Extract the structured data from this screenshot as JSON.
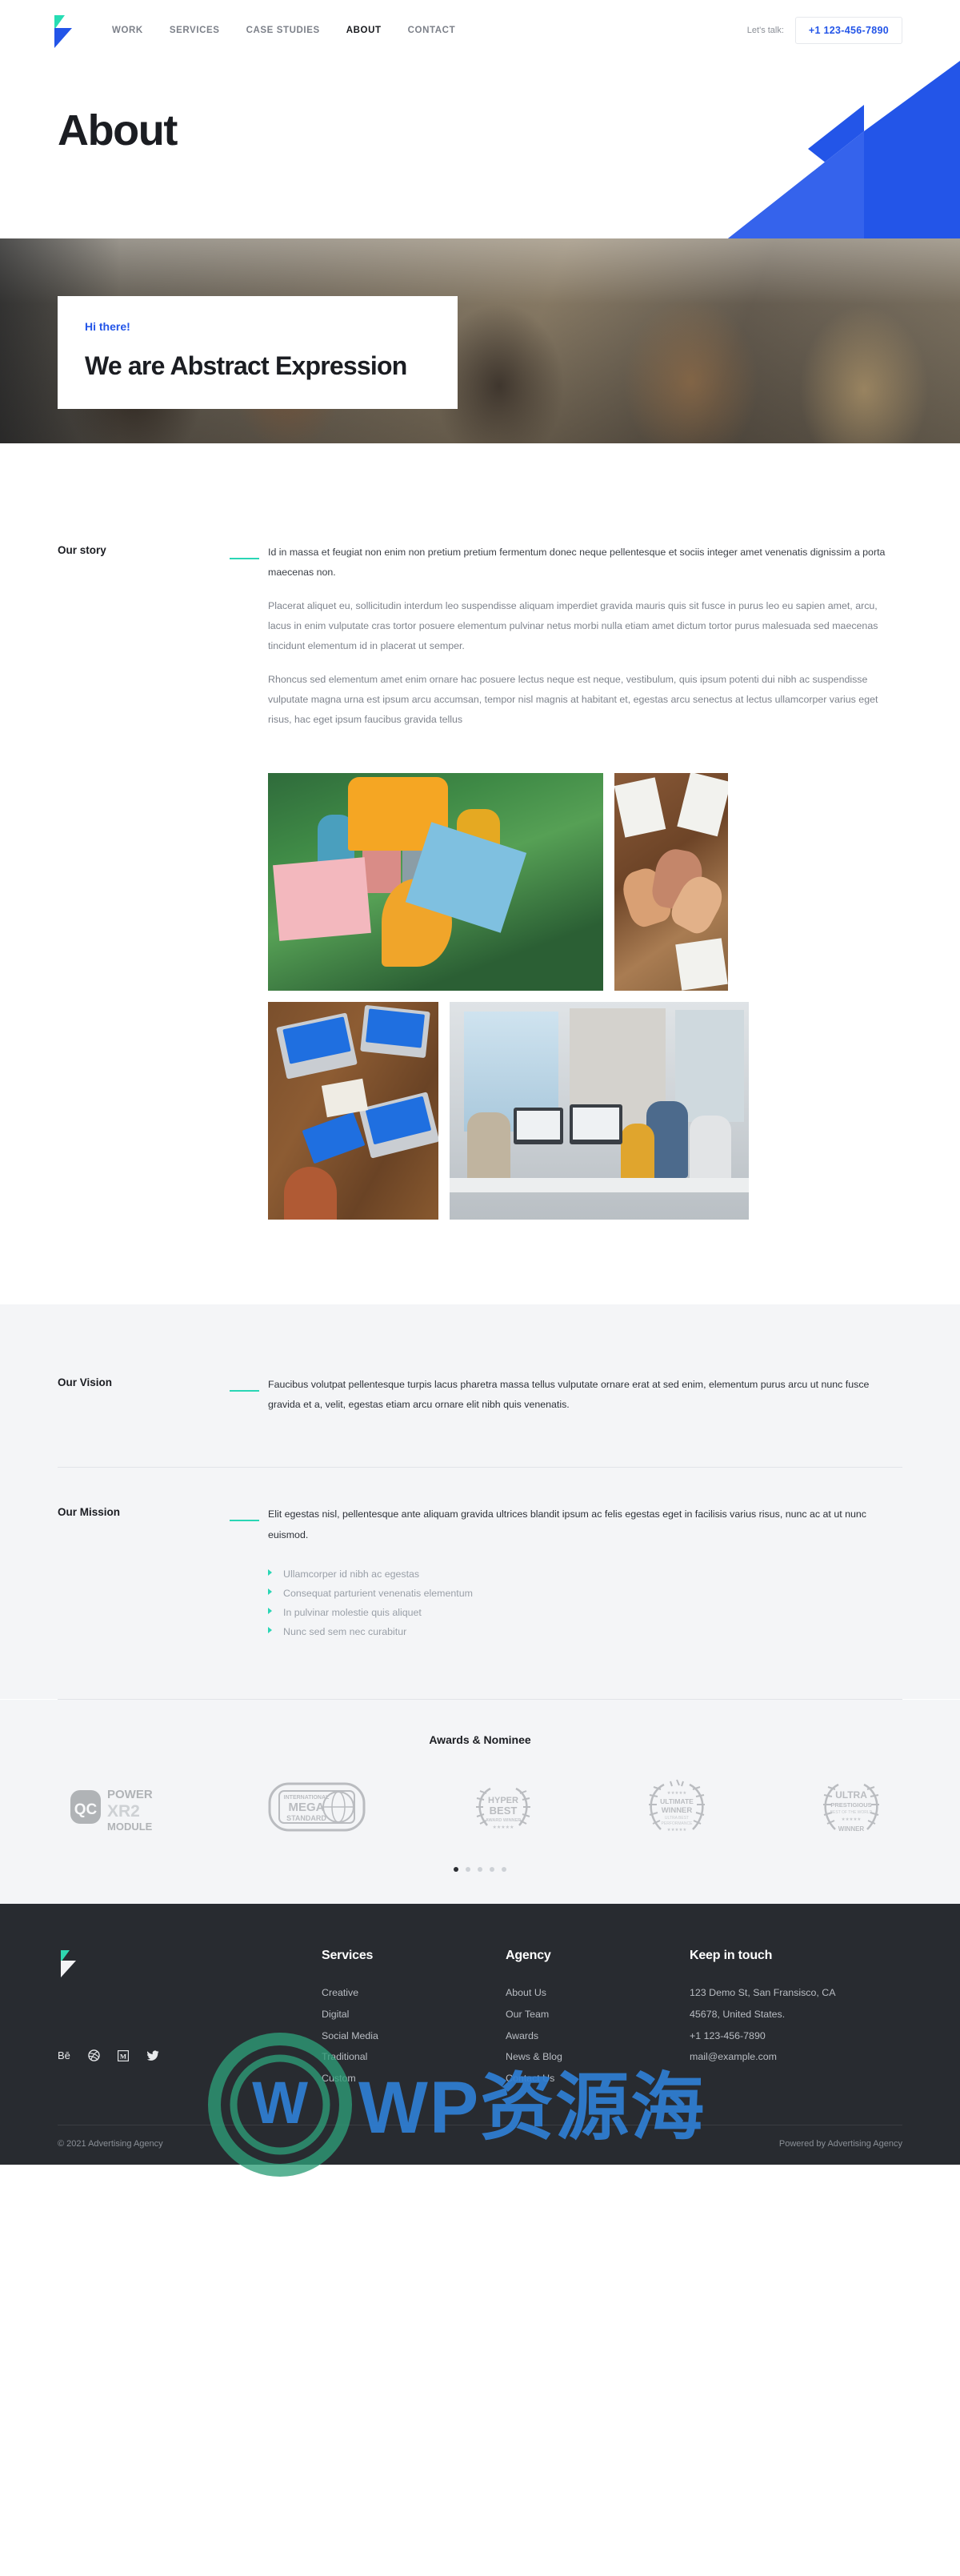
{
  "header": {
    "logo_name": "abstract-logo",
    "nav": [
      {
        "label": "WORK",
        "active": false
      },
      {
        "label": "SERVICES",
        "active": false
      },
      {
        "label": "CASE STUDIES",
        "active": false
      },
      {
        "label": "ABOUT",
        "active": true
      },
      {
        "label": "CONTACT",
        "active": false
      }
    ],
    "lets_talk_label": "Let's talk:",
    "phone": "+1 123-456-7890"
  },
  "page": {
    "title": "About"
  },
  "hero": {
    "kicker": "Hi there!",
    "heading": "We are Abstract Expression"
  },
  "story": {
    "label": "Our story",
    "paragraphs": [
      "Id in massa et feugiat non enim non pretium pretium fermentum donec neque pellentesque et sociis integer amet venenatis dignissim a porta maecenas non.",
      "Placerat aliquet eu, sollicitudin interdum leo suspendisse aliquam imperdiet gravida mauris quis sit fusce in purus leo eu sapien amet, arcu, lacus in enim vulputate cras tortor posuere elementum pulvinar netus morbi nulla etiam amet dictum tortor purus malesuada sed maecenas tincidunt elementum id in placerat ut semper.",
      "Rhoncus sed elementum amet enim ornare hac posuere lectus neque est neque, vestibulum, quis ipsum potenti dui nibh ac suspendisse vulputate magna urna est ipsum arcu accumsan, tempor nisl magnis at habitant et, egestas arcu senectus at lectus ullamcorper varius eget risus, hac eget ipsum faucibus gravida tellus"
    ],
    "gallery": [
      {
        "name": "team-with-colored-signs-photo"
      },
      {
        "name": "hands-together-teamwork-photo"
      },
      {
        "name": "desk-with-laptops-tablets-photo"
      },
      {
        "name": "office-meeting-photo"
      }
    ]
  },
  "vision": {
    "label": "Our Vision",
    "text": "Faucibus volutpat pellentesque turpis lacus pharetra massa tellus vulputate ornare erat at sed enim, elementum purus arcu ut nunc fusce gravida et a, velit, egestas etiam arcu ornare elit nibh quis venenatis."
  },
  "mission": {
    "label": "Our Mission",
    "text": "Elit egestas nisl, pellentesque ante aliquam gravida ultrices blandit ipsum ac felis egestas eget in facilisis varius risus, nunc ac at ut nunc euismod.",
    "items": [
      "Ullamcorper id nibh ac egestas",
      "Consequat parturient venenatis elementum",
      "In pulvinar molestie quis aliquet",
      "Nunc sed sem nec curabitur"
    ]
  },
  "awards": {
    "title": "Awards & Nominee",
    "badges": [
      {
        "name": "qc-power-xr2-module-badge",
        "lines": [
          "QC",
          "POWER",
          "XR2",
          "MODULE"
        ]
      },
      {
        "name": "international-mega-standard-badge",
        "lines": [
          "INTERNATIONAL",
          "MEGA",
          "STANDARD"
        ]
      },
      {
        "name": "hyper-best-award-winner-badge",
        "lines": [
          "HYPER",
          "BEST",
          "AWARD WINNER"
        ]
      },
      {
        "name": "ultimate-winner-badge",
        "lines": [
          "ULTIMATE",
          "WINNER",
          "ULTRA BEST",
          "PERFORMANCE"
        ]
      },
      {
        "name": "ultra-prestigious-winner-badge",
        "lines": [
          "ULTRA",
          "PRESTIGIOUS",
          "BEST OF THE WORLD",
          "WINNER"
        ]
      }
    ],
    "dots": 5,
    "active_dot": 0
  },
  "footer": {
    "socials": [
      {
        "name": "behance-icon",
        "glyph": "Bē"
      },
      {
        "name": "dribbble-icon",
        "glyph": "◉"
      },
      {
        "name": "medium-icon",
        "glyph": "Ⓜ"
      },
      {
        "name": "twitter-icon",
        "glyph": "🐦"
      }
    ],
    "columns": [
      {
        "title": "Services",
        "links": [
          "Creative",
          "Digital",
          "Social Media",
          "Traditional",
          "Custom"
        ]
      },
      {
        "title": "Agency",
        "links": [
          "About Us",
          "Our Team",
          "Awards",
          "News & Blog",
          "Contact Us"
        ]
      }
    ],
    "contact": {
      "title": "Keep in touch",
      "lines": [
        "123 Demo St, San Fransisco, CA",
        "45678, United States.",
        "+1 123-456-7890",
        "mail@example.com"
      ]
    },
    "copyright": "© 2021 Advertising Agency",
    "powered_by": "Powered by Advertising Agency"
  },
  "watermark": {
    "text": "WP资源海"
  },
  "colors": {
    "brand_blue": "#2355e8",
    "accent_teal": "#2ad6b5",
    "dark": "#282b30",
    "band_bg": "#f4f5f7"
  }
}
